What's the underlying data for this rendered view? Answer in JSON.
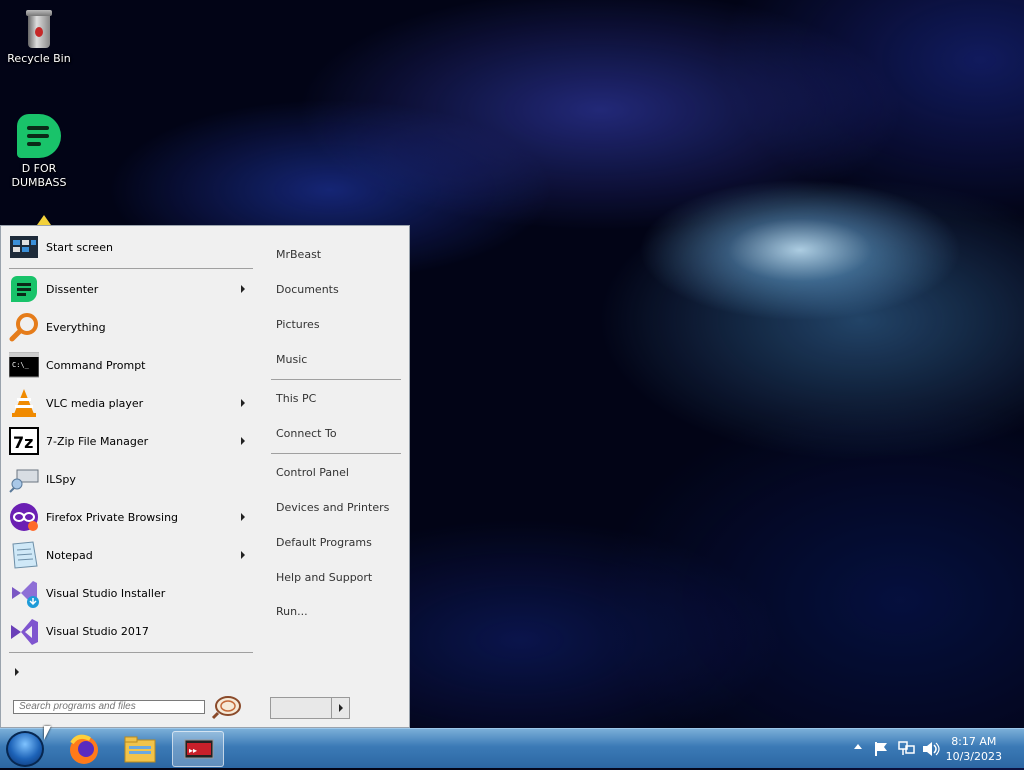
{
  "desktop": {
    "icons": [
      {
        "label": "Recycle Bin"
      },
      {
        "label": "D FOR\nDUMBASS"
      }
    ]
  },
  "start_menu": {
    "programs": [
      {
        "label": "Start screen",
        "has_submenu": false,
        "icon": "start-screen-icon"
      },
      {
        "label": "Dissenter",
        "has_submenu": true,
        "icon": "dissenter-icon"
      },
      {
        "label": "Everything",
        "has_submenu": false,
        "icon": "everything-search-icon"
      },
      {
        "label": "Command Prompt",
        "has_submenu": false,
        "icon": "command-prompt-icon"
      },
      {
        "label": "VLC media player",
        "has_submenu": true,
        "icon": "vlc-cone-icon"
      },
      {
        "label": "7-Zip File Manager",
        "has_submenu": true,
        "icon": "7zip-icon"
      },
      {
        "label": "ILSpy",
        "has_submenu": false,
        "icon": "ilspy-icon"
      },
      {
        "label": "Firefox Private Browsing",
        "has_submenu": true,
        "icon": "firefox-private-icon"
      },
      {
        "label": "Notepad",
        "has_submenu": true,
        "icon": "notepad-icon"
      },
      {
        "label": "Visual Studio Installer",
        "has_submenu": false,
        "icon": "vs-installer-icon"
      },
      {
        "label": "Visual Studio 2017",
        "has_submenu": false,
        "icon": "visual-studio-icon"
      }
    ],
    "search": {
      "placeholder": "Search programs and files"
    },
    "links": {
      "user": "MrBeast",
      "documents": "Documents",
      "pictures": "Pictures",
      "music": "Music",
      "this_pc": "This PC",
      "connect_to": "Connect To",
      "control_panel": "Control Panel",
      "devices_printers": "Devices and Printers",
      "default_programs": "Default Programs",
      "help_support": "Help and Support",
      "run": "Run..."
    }
  },
  "taskbar": {
    "pinned": [
      "firefox-icon",
      "file-explorer-icon",
      "app-window-icon"
    ],
    "tray_icons": [
      "show-hidden-icons-chevron",
      "action-center-flag-icon",
      "network-icon",
      "volume-icon"
    ],
    "clock": {
      "time": "8:17 AM",
      "date": "10/3/2023"
    }
  }
}
